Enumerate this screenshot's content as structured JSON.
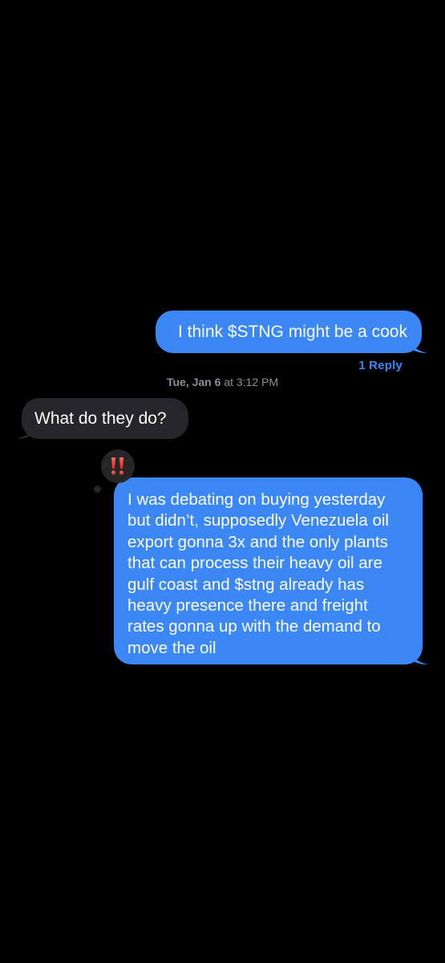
{
  "messages": [
    {
      "direction": "sent",
      "text": "I think $STNG might be a cook",
      "reply_count": "1 Reply"
    },
    {
      "direction": "received",
      "text": "What do they do?"
    },
    {
      "direction": "sent",
      "text": "I was debating on buying yesterday but didn’t, supposedly Venezuela oil export gonna 3x and the only plants that can process their heavy oil are gulf coast and $stng already has heavy presence there and freight rates gonna up with the demand to move the oil",
      "tapback": "‼️",
      "tapback_icon": "exclamation-icon"
    }
  ],
  "timestamp": {
    "day": "Tue, Jan 6",
    "time": "at 3:12 PM"
  },
  "colors": {
    "background": "#000000",
    "sent_bubble": "#3b87f5",
    "received_bubble": "#262628",
    "timestamp_text": "#8e8e93",
    "link": "#3b87f5",
    "tapback_red": "#ff3b30"
  }
}
